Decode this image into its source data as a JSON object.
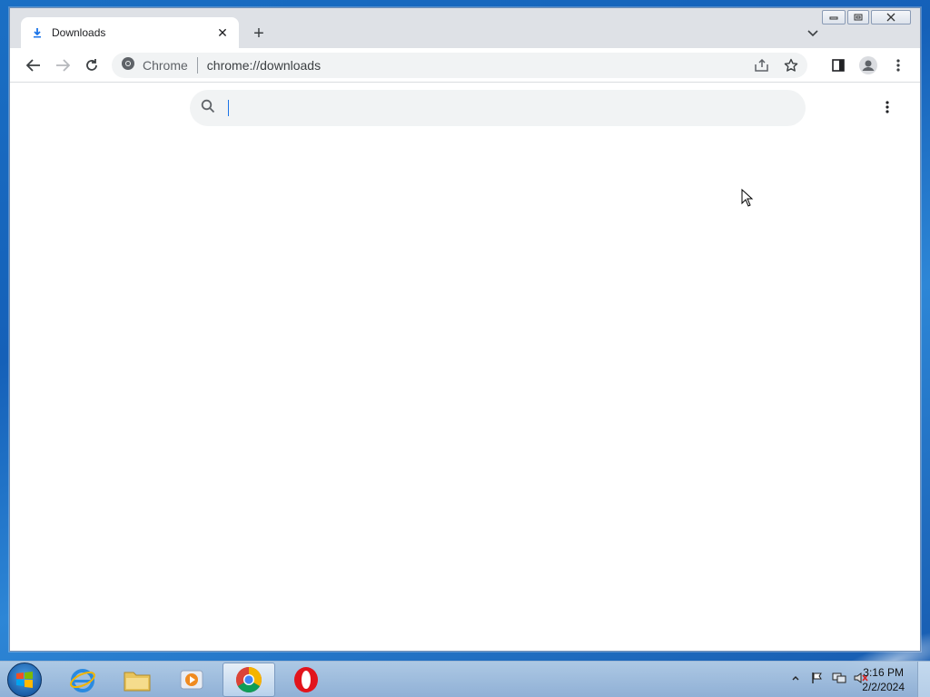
{
  "browser": {
    "tab": {
      "title": "Downloads",
      "close_glyph": "✕"
    },
    "new_tab_glyph": "+",
    "window_controls": {
      "minimize": "—",
      "restore": "❐",
      "close": "✕"
    },
    "omnibox": {
      "site_label": "Chrome",
      "url": "chrome://downloads"
    }
  },
  "downloads_page": {
    "search": {
      "value": "",
      "placeholder": ""
    }
  },
  "taskbar": {
    "apps": [
      "internet-explorer",
      "file-explorer",
      "media-player",
      "google-chrome",
      "opera"
    ],
    "active_app": "google-chrome",
    "clock": {
      "time": "3:16 PM",
      "date": "2/2/2024"
    }
  },
  "colors": {
    "accent": "#1a73e8",
    "tab_strip": "#dee1e6",
    "omnibox_bg": "#f1f3f4"
  }
}
